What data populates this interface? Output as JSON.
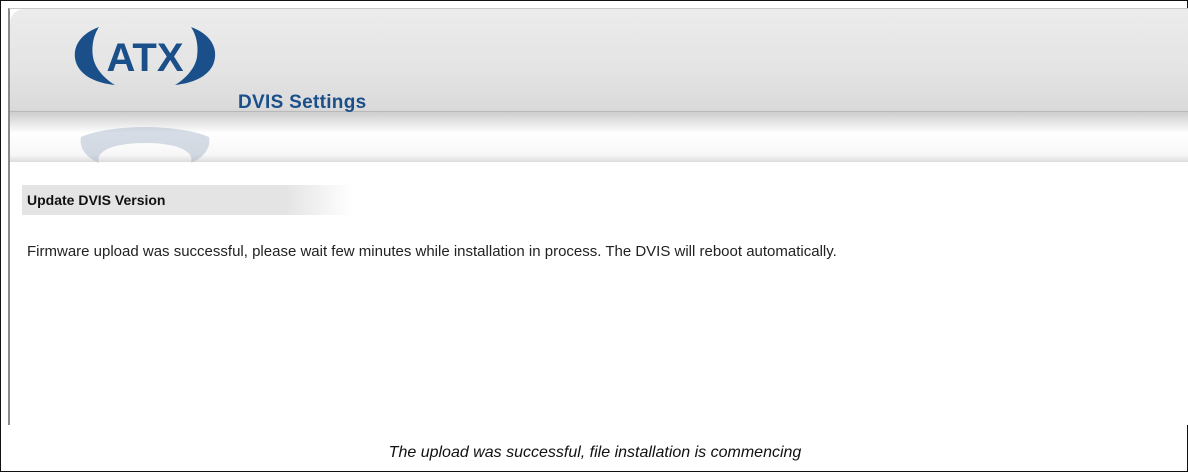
{
  "header": {
    "logo_text": "ATX",
    "page_title": "DVIS Settings"
  },
  "section": {
    "title": "Update DVIS Version"
  },
  "message": {
    "text": "Firmware upload was successful, please wait few minutes while installation in process. The DVIS will reboot automatically."
  },
  "caption": {
    "text": "The upload was successful, file installation is commencing"
  },
  "colors": {
    "brand_blue": "#1a4f8a",
    "section_bg": "#e4e4e4"
  },
  "icons": {
    "logo": "atx-logo"
  }
}
